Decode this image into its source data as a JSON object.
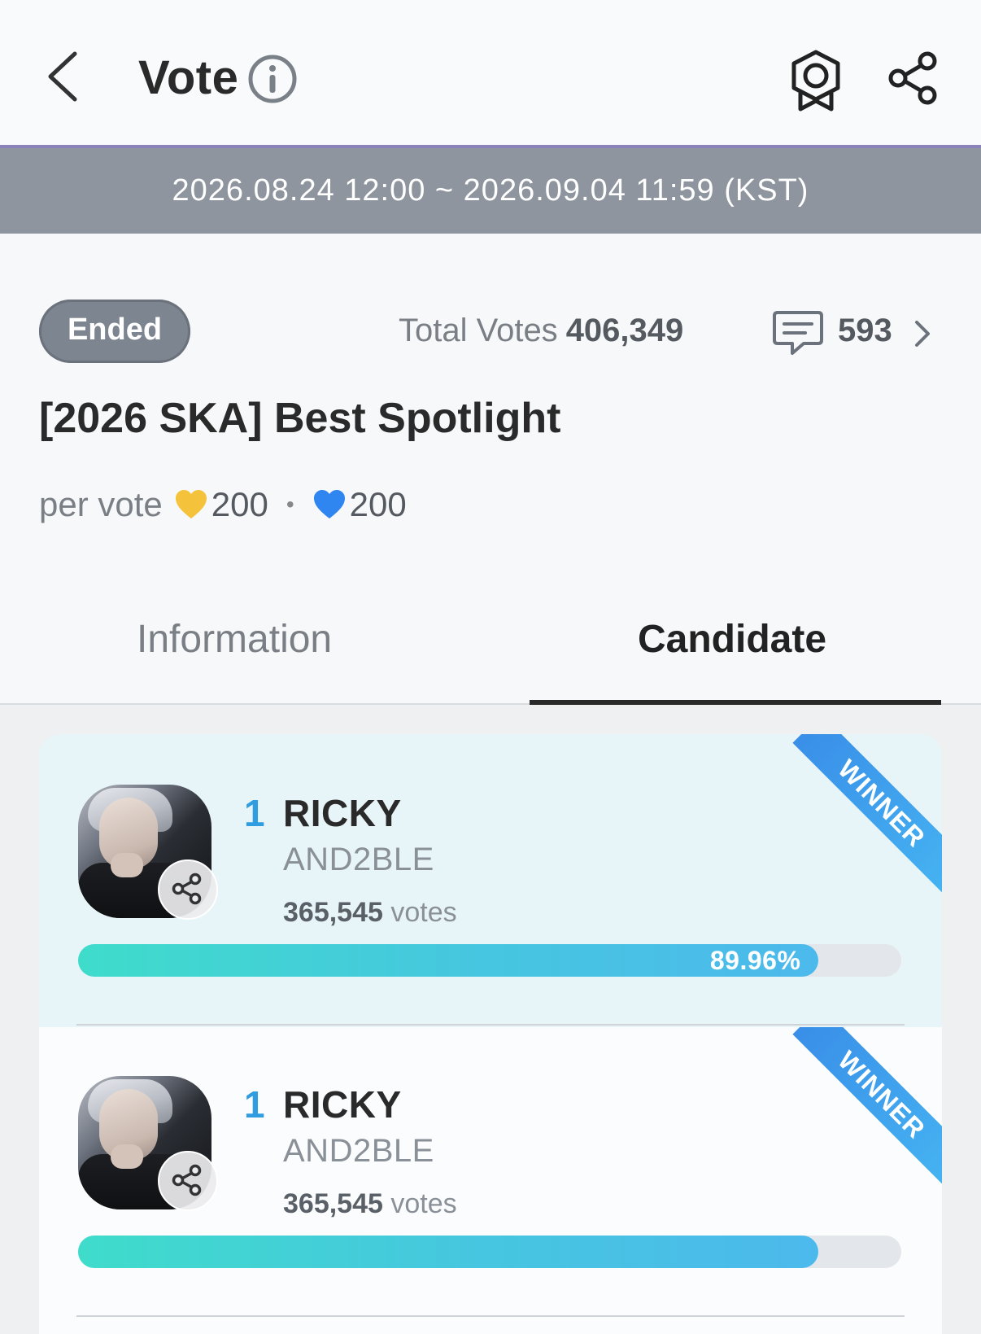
{
  "header": {
    "title": "Vote",
    "icons": [
      "chevron-left-icon",
      "info-icon",
      "medal-icon",
      "share-icon"
    ]
  },
  "period": "2026.08.24 12:00 ~ 2026.09.04 11:59 (KST)",
  "vote": {
    "status": "Ended",
    "total_votes_label": "Total Votes",
    "total_votes_value": "406,349",
    "comment_count": "593",
    "title": "[2026 SKA] Best Spotlight",
    "per_vote_label": "per vote",
    "cost_gold_heart": "200",
    "cost_blue_heart": "200",
    "separator": "•"
  },
  "tabs": {
    "information": "Information",
    "candidate": "Candidate",
    "active": "Candidate"
  },
  "candidates": [
    {
      "rank": "1",
      "name": "RICKY",
      "group": "AND2BLE",
      "votes_value": "365,545",
      "votes_unit": "votes",
      "percent_label": "89.96%",
      "percent": 89.96,
      "ribbon": "WINNER"
    },
    {
      "rank": "1",
      "name": "RICKY",
      "group": "AND2BLE",
      "votes_value": "365,545",
      "votes_unit": "votes",
      "percent_label": "",
      "percent": 89.96,
      "ribbon": "WINNER"
    }
  ],
  "colors": {
    "accent_blue": "#2f9de0",
    "period_bar": "#8e959e",
    "gold_heart": "#f5c33b",
    "blue_heart": "#2f86f0",
    "bar_gradient_start": "#3fdccb",
    "bar_gradient_end": "#4cb9ec"
  }
}
